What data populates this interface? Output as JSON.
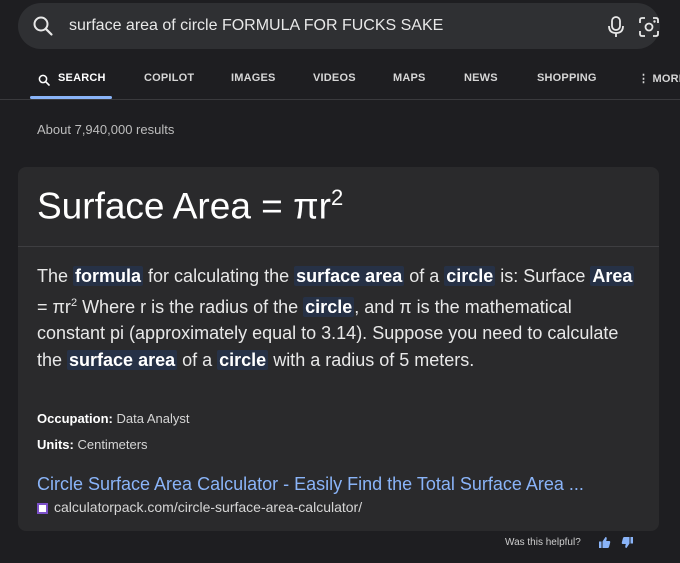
{
  "search": {
    "query": "surface area of circle FORMULA FOR FUCKS SAKE",
    "icons": [
      "search-icon",
      "microphone-icon",
      "lens-icon"
    ]
  },
  "tabs": [
    {
      "label": "SEARCH",
      "active": true
    },
    {
      "label": "COPILOT"
    },
    {
      "label": "IMAGES"
    },
    {
      "label": "VIDEOS"
    },
    {
      "label": "MAPS"
    },
    {
      "label": "NEWS"
    },
    {
      "label": "SHOPPING"
    },
    {
      "label": "MORE"
    }
  ],
  "results_count": "About 7,940,000 results",
  "card": {
    "heading": "Surface Area = πr",
    "heading_sup": "2",
    "answer": {
      "p1": "The ",
      "hl1": "formula",
      "p2": " for calculating the ",
      "hl2": "surface area",
      "p3": " of a ",
      "hl3": "circle",
      "p4": " is: Surface ",
      "hl4": "Area",
      "p5": " = πr",
      "sup": "2",
      "p6": " Where r is the radius of the ",
      "hl5": "circle",
      "p7": ", and π is the mathematical constant pi (approximately equal to 3.14). Suppose you need to calculate the ",
      "hl6": "surface area",
      "p8": " of a ",
      "hl7": "circle",
      "p9": " with a radius of 5 meters."
    },
    "occupation_label": "Occupation:",
    "occupation_value": "Data Analyst",
    "units_label": "Units:",
    "units_value": "Centimeters",
    "link_title": "Circle Surface Area Calculator - Easily Find the Total Surface Area ...",
    "url": "calculatorpack.com/circle-surface-area-calculator/"
  },
  "feedback": {
    "label": "Was this helpful?"
  },
  "colors": {
    "accent": "#8ab4f8",
    "background": "#1e1e21",
    "card": "#2a2a2c",
    "highlight": "#263146"
  }
}
